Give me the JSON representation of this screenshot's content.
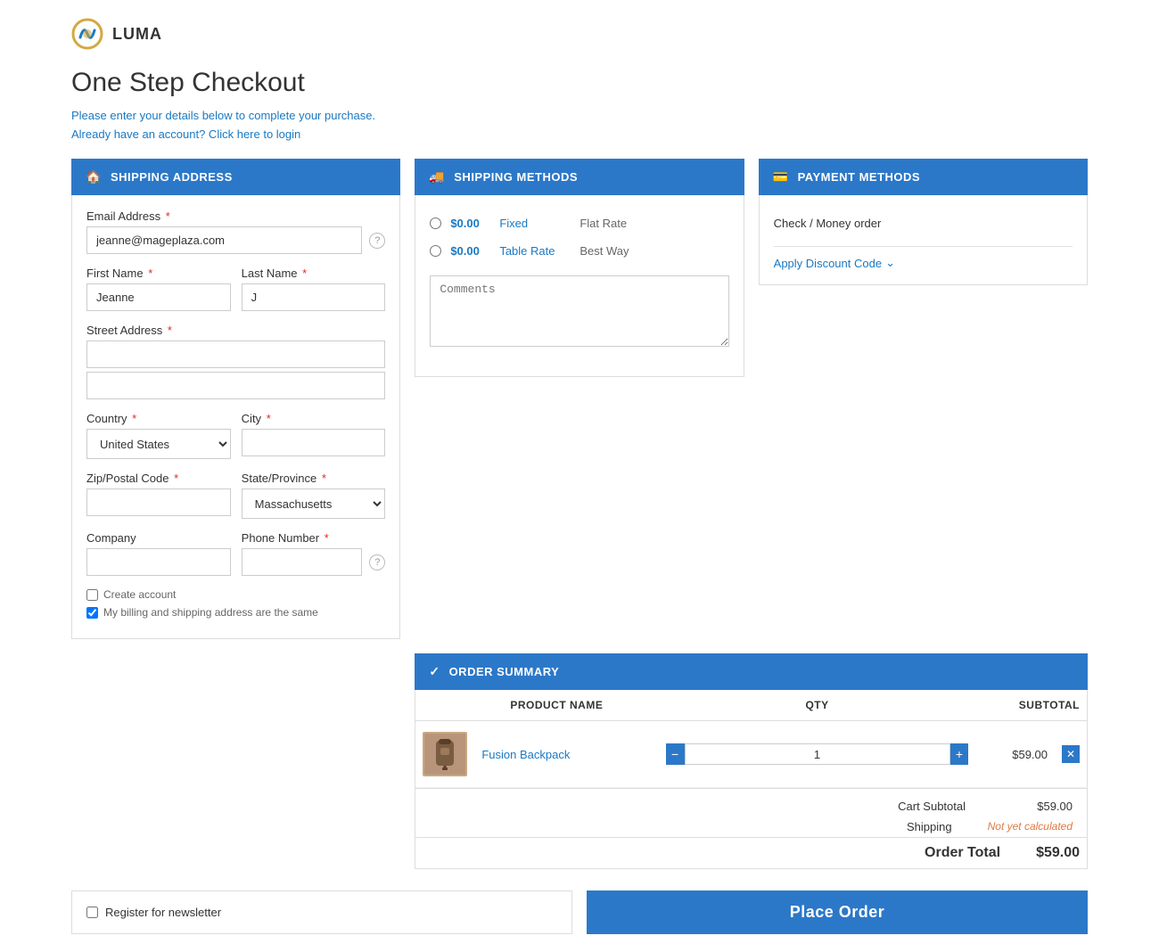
{
  "logo": {
    "text": "LUMA"
  },
  "page": {
    "title": "One Step Checkout",
    "subtitle": "Please enter your details below to complete your purchase.",
    "login_link": "Already have an account? Click here to login"
  },
  "shipping_address": {
    "header": "SHIPPING ADDRESS",
    "email_label": "Email Address",
    "email_value": "jeanne@mageplaza.com",
    "email_placeholder": "",
    "firstname_label": "First Name",
    "firstname_value": "Jeanne",
    "lastname_label": "Last Name",
    "lastname_value": "J",
    "street_label": "Street Address",
    "country_label": "Country",
    "country_value": "United States",
    "city_label": "City",
    "zip_label": "Zip/Postal Code",
    "state_label": "State/Province",
    "state_value": "Massachusetts",
    "company_label": "Company",
    "phone_label": "Phone Number",
    "create_account": "Create account",
    "billing_same": "My billing and shipping address are the same"
  },
  "shipping_methods": {
    "header": "SHIPPING METHODS",
    "options": [
      {
        "price": "$0.00",
        "type": "Fixed",
        "name": "Flat Rate"
      },
      {
        "price": "$0.00",
        "type": "Table Rate",
        "name": "Best Way"
      }
    ],
    "comments_placeholder": "Comments"
  },
  "payment_methods": {
    "header": "PAYMENT METHODS",
    "method": "Check / Money order",
    "discount_label": "Apply Discount Code"
  },
  "order_summary": {
    "header": "ORDER SUMMARY",
    "columns": {
      "product": "PRODUCT NAME",
      "qty": "QTY",
      "subtotal": "SUBTOTAL"
    },
    "items": [
      {
        "name": "Fusion Backpack",
        "qty": 1,
        "price": "$59.00"
      }
    ],
    "cart_subtotal_label": "Cart Subtotal",
    "cart_subtotal_value": "$59.00",
    "shipping_label": "Shipping",
    "shipping_value": "Not yet calculated",
    "order_total_label": "Order Total",
    "order_total_value": "$59.00"
  },
  "newsletter": {
    "label": "Register for newsletter"
  },
  "place_order": {
    "label": "Place Order"
  }
}
